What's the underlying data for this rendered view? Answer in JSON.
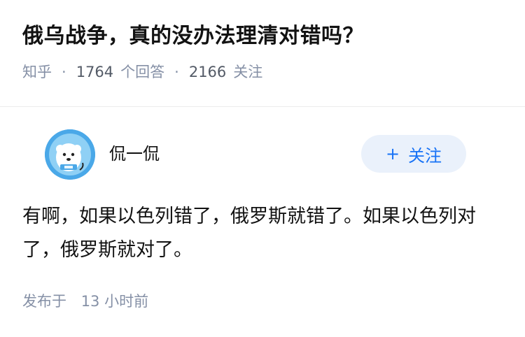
{
  "question": {
    "title": "俄乌战争，真的没办法理清对错吗？",
    "source": "知乎",
    "answers_count": "1764",
    "answers_label": "个回答",
    "follows_count": "2166",
    "follows_label": "关注"
  },
  "answer": {
    "author_name": "侃一侃",
    "follow_button": "关注",
    "content": "有啊，如果以色列错了，俄罗斯就错了。如果以色列对了，俄罗斯就对了。",
    "time_prefix": "发布于",
    "time_value": "13 小时前"
  },
  "colors": {
    "accent": "#1772f6",
    "meta": "#8590a6",
    "avatar_bg": "#4aa8e8"
  },
  "icons": [
    "plus-icon",
    "avatar-polar-bear"
  ]
}
